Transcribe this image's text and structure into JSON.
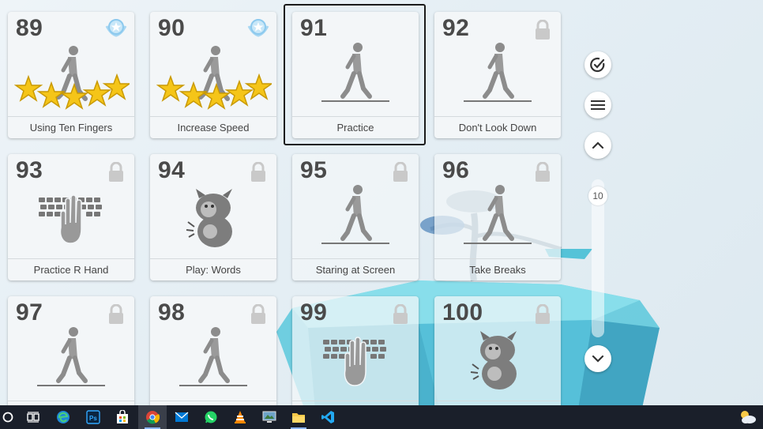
{
  "lessons": [
    {
      "number": "89",
      "label": "Using Ten Fingers",
      "icon": "walking-person-icon",
      "stars": 5,
      "state": "completed",
      "badge": "mastery-badge-icon"
    },
    {
      "number": "90",
      "label": "Increase Speed",
      "icon": "walking-person-icon",
      "stars": 5,
      "state": "completed",
      "badge": "mastery-badge-icon"
    },
    {
      "number": "91",
      "label": "Practice",
      "icon": "walking-person-icon",
      "stars": 0,
      "state": "current"
    },
    {
      "number": "92",
      "label": "Don't Look Down",
      "icon": "walking-person-icon",
      "stars": 0,
      "state": "locked"
    },
    {
      "number": "93",
      "label": "Practice R Hand",
      "icon": "keyboard-hand-icon",
      "stars": 0,
      "state": "locked"
    },
    {
      "number": "94",
      "label": "Play: Words",
      "icon": "monster-game-icon",
      "stars": 0,
      "state": "locked"
    },
    {
      "number": "95",
      "label": "Staring at Screen",
      "icon": "walking-person-icon",
      "stars": 0,
      "state": "locked"
    },
    {
      "number": "96",
      "label": "Take Breaks",
      "icon": "walking-person-icon",
      "stars": 0,
      "state": "locked"
    },
    {
      "number": "97",
      "label": "",
      "icon": "walking-person-icon",
      "stars": 0,
      "state": "locked"
    },
    {
      "number": "98",
      "label": "",
      "icon": "walking-person-icon",
      "stars": 0,
      "state": "locked"
    },
    {
      "number": "99",
      "label": "",
      "icon": "keyboard-hand-icon",
      "stars": 0,
      "state": "locked"
    },
    {
      "number": "100",
      "label": "",
      "icon": "monster-game-icon",
      "stars": 0,
      "state": "locked"
    }
  ],
  "sidebar": {
    "buttons": [
      "check-circle-icon",
      "menu-icon",
      "chevron-up-icon",
      "chevron-down-icon"
    ],
    "page_indicator": "10"
  },
  "taskbar": {
    "items": [
      "start-circle-icon",
      "task-view-icon",
      "edge-icon",
      "photoshop-icon",
      "store-icon",
      "chrome-icon",
      "mail-icon",
      "whatsapp-icon",
      "vlc-icon",
      "screen-icon",
      "file-explorer-icon",
      "vscode-icon"
    ],
    "active": "chrome-icon",
    "tray": [
      "weather-icon"
    ]
  },
  "colors": {
    "card_bg": "#f3f6f8",
    "number_text": "#4a4a4a",
    "star_fill": "#f5c518",
    "lock_color": "#c9c9c9",
    "figure_color": "#9a9a9a",
    "taskbar_bg": "#1a1f2a"
  }
}
